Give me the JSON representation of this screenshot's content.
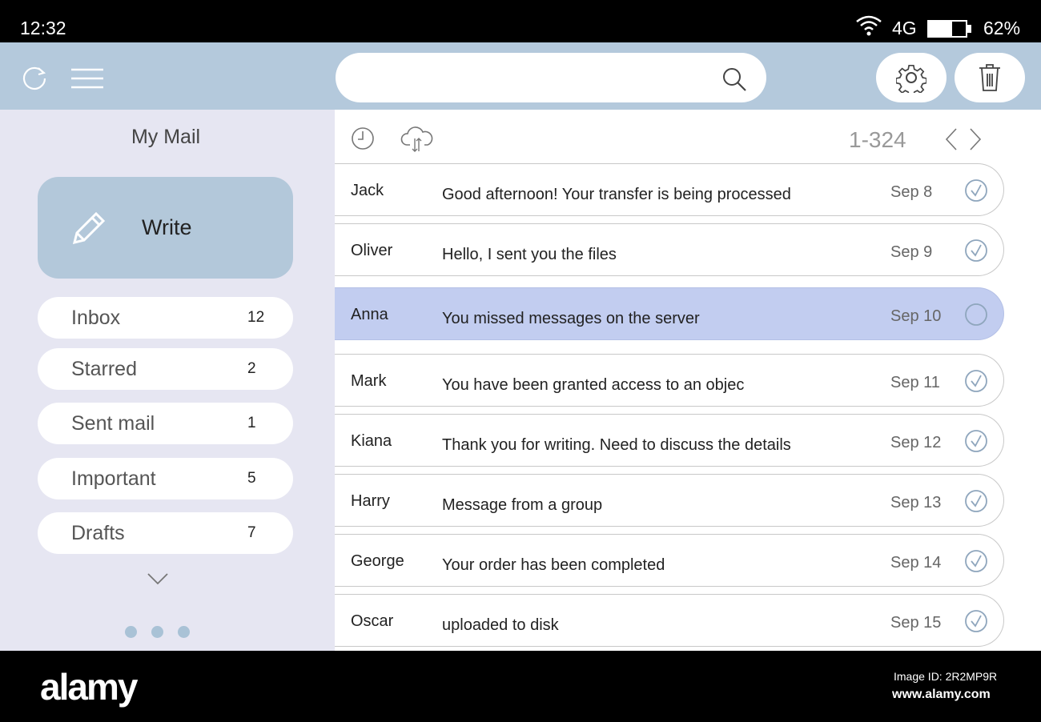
{
  "status": {
    "time": "12:32",
    "network": "4G",
    "battery": "62%",
    "battery_level": 0.62
  },
  "header": {
    "search_placeholder": "",
    "icons": [
      "refresh-icon",
      "menu-icon",
      "search-icon",
      "gear-icon",
      "trash-icon"
    ]
  },
  "sidebar": {
    "title": "My Mail",
    "write_label": "Write",
    "items": [
      {
        "label": "Inbox",
        "count": "12"
      },
      {
        "label": "Starred",
        "count": "2"
      },
      {
        "label": "Sent mail",
        "count": "1"
      },
      {
        "label": "Important",
        "count": "5"
      },
      {
        "label": "Drafts",
        "count": "7"
      }
    ]
  },
  "toolbar": {
    "range": "1-324"
  },
  "messages": [
    {
      "sender": "Jack",
      "subject": "Good afternoon! Your transfer is being processed",
      "date": "Sep 8",
      "checked": true
    },
    {
      "sender": "Oliver",
      "subject": "Hello, I sent you the files",
      "date": "Sep 9",
      "checked": true
    },
    {
      "sender": "Anna",
      "subject": "You missed messages on the server",
      "date": "Sep 10",
      "checked": false,
      "selected": true
    },
    {
      "sender": "Mark",
      "subject": "You have been granted access to an objec",
      "date": "Sep 11",
      "checked": true
    },
    {
      "sender": "Kiana",
      "subject": "Thank you for writing. Need to discuss the details",
      "date": "Sep 12",
      "checked": true
    },
    {
      "sender": "Harry",
      "subject": "Message from a group",
      "date": "Sep 13",
      "checked": true
    },
    {
      "sender": "George",
      "subject": "Your order has been completed",
      "date": "Sep 14",
      "checked": true
    },
    {
      "sender": "Oscar",
      "subject": " uploaded to disk",
      "date": "Sep 15",
      "checked": true
    }
  ],
  "footer": {
    "logo": "alamy",
    "image_id": "Image ID: 2R2MP9R",
    "site": "www.alamy.com"
  },
  "colors": {
    "header": "#b4c9dc",
    "sidebar": "#e6e6f2",
    "write": "#b3c8da",
    "selected": "#c2cdf0",
    "check": "#8fa6bd"
  }
}
